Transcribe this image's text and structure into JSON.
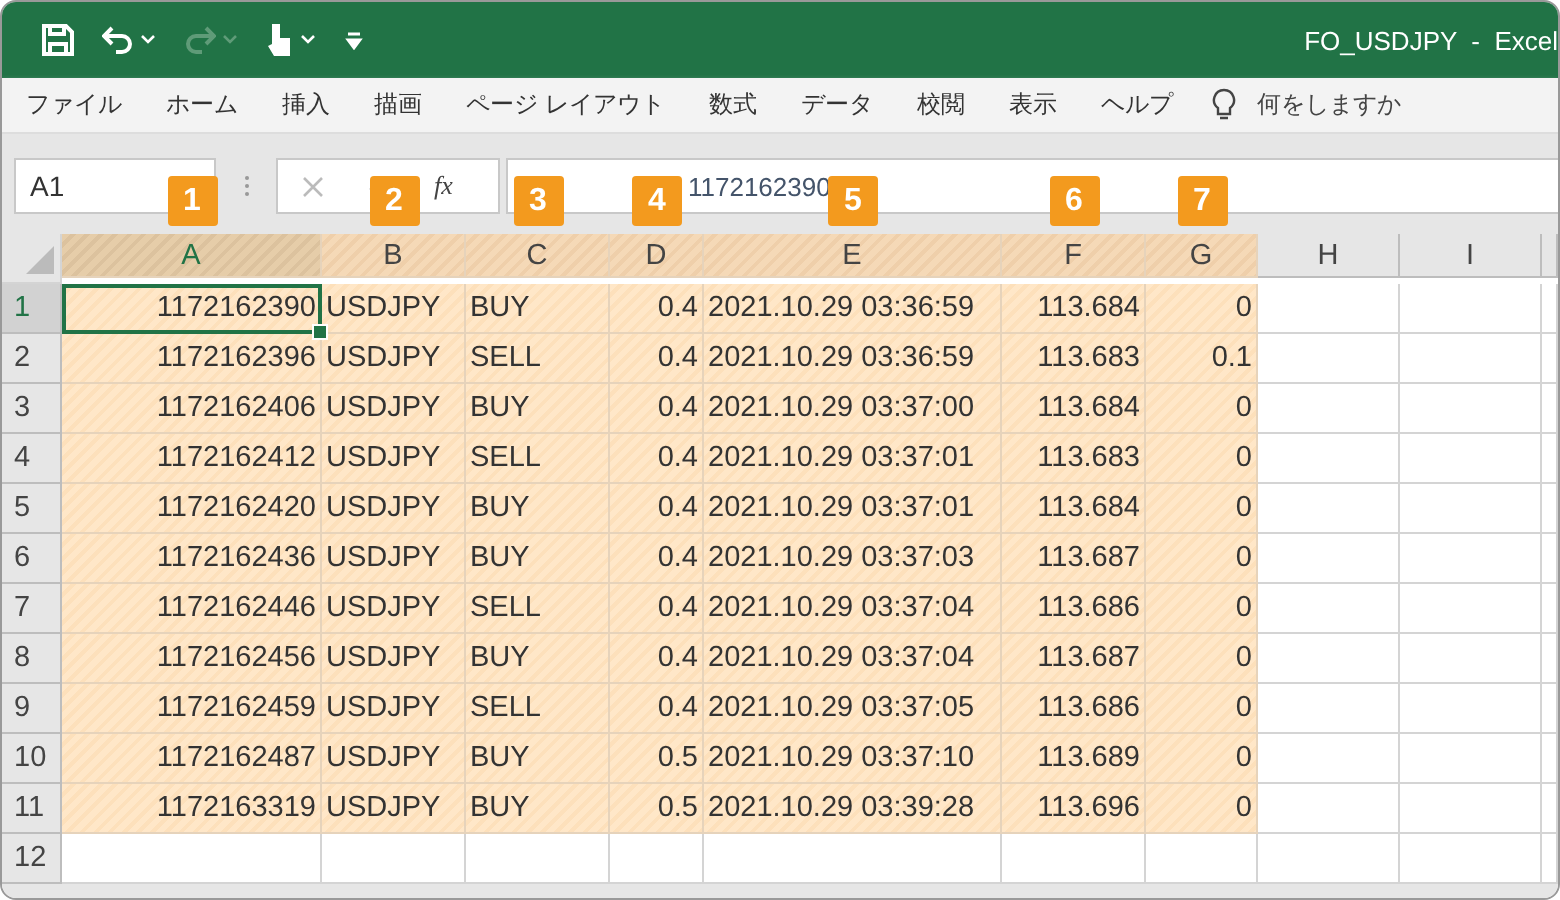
{
  "window": {
    "title": "FO_USDJPY  -  Excel"
  },
  "quick_access": [
    {
      "kind": "save",
      "caret": false,
      "disabled": false
    },
    {
      "kind": "undo",
      "caret": true,
      "disabled": false
    },
    {
      "kind": "redo",
      "caret": true,
      "disabled": true
    },
    {
      "kind": "touch",
      "caret": true,
      "disabled": false
    },
    {
      "kind": "customize",
      "caret": false,
      "disabled": false
    }
  ],
  "ribbon_tabs": [
    "ファイル",
    "ホーム",
    "挿入",
    "描画",
    "ページ レイアウト",
    "数式",
    "データ",
    "校閲",
    "表示",
    "ヘルプ"
  ],
  "tell_me": {
    "placeholder": "何をしますか"
  },
  "formula_bar": {
    "name_box": "A1",
    "function_label": "fx",
    "value": "1172162390"
  },
  "columns": [
    {
      "label": "A",
      "badge": "1",
      "highlighted": true,
      "selected": true
    },
    {
      "label": "B",
      "badge": "2",
      "highlighted": true,
      "selected": false
    },
    {
      "label": "C",
      "badge": "3",
      "highlighted": true,
      "selected": false
    },
    {
      "label": "D",
      "badge": "4",
      "highlighted": true,
      "selected": false
    },
    {
      "label": "E",
      "badge": "5",
      "highlighted": true,
      "selected": false
    },
    {
      "label": "F",
      "badge": "6",
      "highlighted": true,
      "selected": false
    },
    {
      "label": "G",
      "badge": "7",
      "highlighted": true,
      "selected": false
    },
    {
      "label": "H",
      "highlighted": false,
      "selected": false
    },
    {
      "label": "I",
      "highlighted": false,
      "selected": false
    }
  ],
  "rows": [
    {
      "header": "1",
      "selected": true,
      "cells": [
        "1172162390",
        "USDJPY",
        "BUY",
        "0.4",
        "2021.10.29 03:36:59",
        "113.684",
        "0"
      ]
    },
    {
      "header": "2",
      "selected": false,
      "cells": [
        "1172162396",
        "USDJPY",
        "SELL",
        "0.4",
        "2021.10.29 03:36:59",
        "113.683",
        "0.1"
      ]
    },
    {
      "header": "3",
      "selected": false,
      "cells": [
        "1172162406",
        "USDJPY",
        "BUY",
        "0.4",
        "2021.10.29 03:37:00",
        "113.684",
        "0"
      ]
    },
    {
      "header": "4",
      "selected": false,
      "cells": [
        "1172162412",
        "USDJPY",
        "SELL",
        "0.4",
        "2021.10.29 03:37:01",
        "113.683",
        "0"
      ]
    },
    {
      "header": "5",
      "selected": false,
      "cells": [
        "1172162420",
        "USDJPY",
        "BUY",
        "0.4",
        "2021.10.29 03:37:01",
        "113.684",
        "0"
      ]
    },
    {
      "header": "6",
      "selected": false,
      "cells": [
        "1172162436",
        "USDJPY",
        "BUY",
        "0.4",
        "2021.10.29 03:37:03",
        "113.687",
        "0"
      ]
    },
    {
      "header": "7",
      "selected": false,
      "cells": [
        "1172162446",
        "USDJPY",
        "SELL",
        "0.4",
        "2021.10.29 03:37:04",
        "113.686",
        "0"
      ]
    },
    {
      "header": "8",
      "selected": false,
      "cells": [
        "1172162456",
        "USDJPY",
        "BUY",
        "0.4",
        "2021.10.29 03:37:04",
        "113.687",
        "0"
      ]
    },
    {
      "header": "9",
      "selected": false,
      "cells": [
        "1172162459",
        "USDJPY",
        "SELL",
        "0.4",
        "2021.10.29 03:37:05",
        "113.686",
        "0"
      ]
    },
    {
      "header": "10",
      "selected": false,
      "cells": [
        "1172162487",
        "USDJPY",
        "BUY",
        "0.5",
        "2021.10.29 03:37:10",
        "113.689",
        "0"
      ]
    },
    {
      "header": "11",
      "selected": false,
      "cells": [
        "1172163319",
        "USDJPY",
        "BUY",
        "0.5",
        "2021.10.29 03:39:28",
        "113.696",
        "0"
      ]
    },
    {
      "header": "12",
      "selected": false,
      "cells": []
    }
  ]
}
